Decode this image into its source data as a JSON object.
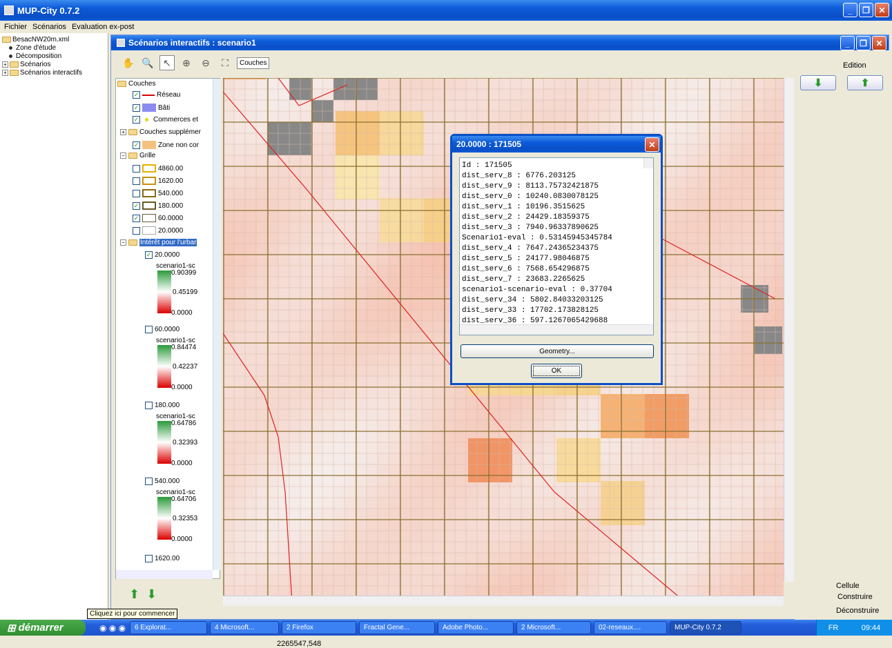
{
  "app_title": "MUP-City 0.7.2",
  "menu": [
    "Fichier",
    "Scénarios",
    "Evaluation ex-post"
  ],
  "left_tree": {
    "root": "BesacNW20m.xml",
    "items": [
      "Zone d'étude",
      "Décomposition",
      "Scénarios",
      "Scénarios interactifs"
    ]
  },
  "inner_window_title": "Scénarios interactifs : scenario1",
  "toolbar": {
    "couches_label": "Couches"
  },
  "layers": {
    "root": "Couches",
    "reseau": "Réseau",
    "bati": "Bâti",
    "commerces": "Commerces et",
    "supplementaires": "Couches supplémer",
    "zone_non": "Zone non cor",
    "grille": "Grille",
    "grid_levels": [
      "4860.00",
      "1620.00",
      "540.000",
      "180.000",
      "60.0000",
      "20.0000"
    ],
    "interet": "Intérêt pour l'urbar",
    "legends": [
      {
        "level": "20.0000",
        "name": "scenario1-sc",
        "max": "0.90399",
        "mid": "0.45199",
        "min": "0.0000"
      },
      {
        "level": "60.0000",
        "name": "scenario1-sc",
        "max": "0.84474",
        "mid": "0.42237",
        "min": "0.0000"
      },
      {
        "level": "180.000",
        "name": "scenario1-sc",
        "max": "0.64786",
        "mid": "0.32393",
        "min": "0.0000"
      },
      {
        "level": "540.000",
        "name": "scenario1-sc",
        "max": "0.64706",
        "mid": "0.32353",
        "min": "0.0000"
      }
    ],
    "last_level": "1620.00"
  },
  "coord_readout": "2265547,548",
  "right_panel": {
    "edition": "Edition",
    "cellule": "Cellule",
    "construire": "Construire",
    "deconstruire": "Déconstruire"
  },
  "dialog": {
    "title": "20.0000 : 171505",
    "lines": [
      "Id : 171505",
      "dist_serv_8 : 6776.203125",
      "dist_serv_9 : 8113.75732421875",
      "dist_serv_0 : 10240.0830078125",
      "dist_serv_1 : 10196.3515625",
      "dist_serv_2 : 24429.18359375",
      "dist_serv_3 : 7940.96337890625",
      "Scenario1-eval : 0.53145945345784",
      "dist_serv_4 : 7647.24365234375",
      "dist_serv_5 : 24177.98046875",
      "dist_serv_6 : 7568.654296875",
      "dist_serv_7 : 23683.2265625",
      "scenario1-scenario-eval : 0.37704",
      "dist_serv_34 : 5802.84033203125",
      "dist_serv_33 : 17702.173828125",
      "dist_serv_36 : 597.1267065429688"
    ],
    "geometry_button": "Geometry...",
    "ok_button": "OK"
  },
  "taskbar": {
    "start": "démarrer",
    "tasks": [
      "6 Explorat...",
      "4 Microsoft...",
      "2 Firefox",
      "Fractal Gene...",
      "Adobe Photo...",
      "2 Microsoft...",
      "02-reseaux....",
      "MUP-City 0.7.2"
    ],
    "lang": "FR",
    "clock": "09:44"
  },
  "tooltip": "Cliquez ici pour commencer"
}
